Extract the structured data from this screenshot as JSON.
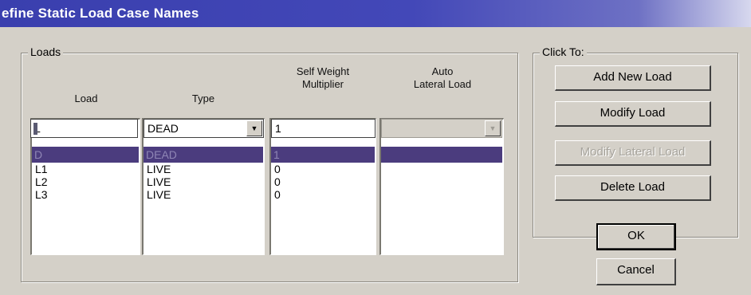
{
  "window": {
    "title": "efine Static Load Case Names"
  },
  "loads_group": {
    "label": "Loads",
    "columns": {
      "load": "Load",
      "type": "Type",
      "self_weight": [
        "Self Weight",
        "Multiplier"
      ],
      "auto_lateral": [
        "Auto",
        "Lateral Load"
      ]
    },
    "edit": {
      "load": "L",
      "type": "DEAD",
      "self_weight": "1",
      "auto_lateral": ""
    },
    "selected_row": {
      "load": "D",
      "type": "DEAD",
      "self_weight": "1"
    },
    "rows": [
      {
        "load": "L1",
        "type": "LIVE",
        "self_weight": "0"
      },
      {
        "load": "L2",
        "type": "LIVE",
        "self_weight": "0"
      },
      {
        "load": "L3",
        "type": "LIVE",
        "self_weight": "0"
      }
    ]
  },
  "click_to_group": {
    "label": "Click To:",
    "buttons": {
      "add": "Add New Load",
      "modify": "Modify Load",
      "modify_lateral": "Modify Lateral Load",
      "delete": "Delete Load"
    }
  },
  "footer": {
    "ok": "OK",
    "cancel": "Cancel"
  },
  "icons": {
    "dropdown": "chevron-down-icon"
  }
}
